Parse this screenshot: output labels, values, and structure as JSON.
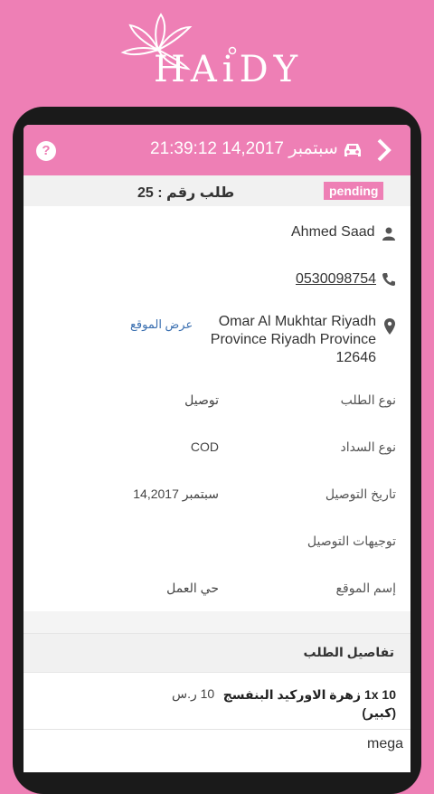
{
  "brand": {
    "name": "HAiDY"
  },
  "header": {
    "help_label": "?",
    "date_time": "سبتمبر 14,2017 21:39:12"
  },
  "order": {
    "number_label": "طلب رقم : 25",
    "status": "pending"
  },
  "customer": {
    "name": "Ahmed Saad",
    "phone": "0530098754",
    "address": "Omar Al Mukhtar Riyadh Province Riyadh Province 12646",
    "map_link": "عرض الموقع"
  },
  "details": [
    {
      "label": "نوع الطلب",
      "value": "توصيل"
    },
    {
      "label": "نوع السداد",
      "value": "COD"
    },
    {
      "label": "تاريخ التوصيل",
      "value": "سبتمبر 14,2017"
    },
    {
      "label": "توجيهات التوصيل",
      "value": ""
    },
    {
      "label": "إسم الموقع",
      "value": "حي العمل"
    }
  ],
  "items_section": {
    "title": "تفاصيل الطلب",
    "items": [
      {
        "line": "10 1x زهرة الاوركيد البنفسج (كبير)",
        "price": "10 ر.س"
      }
    ],
    "extra": "mega"
  },
  "colors": {
    "brand_pink": "#ee7fb5",
    "link_blue": "#3a6fb0"
  }
}
